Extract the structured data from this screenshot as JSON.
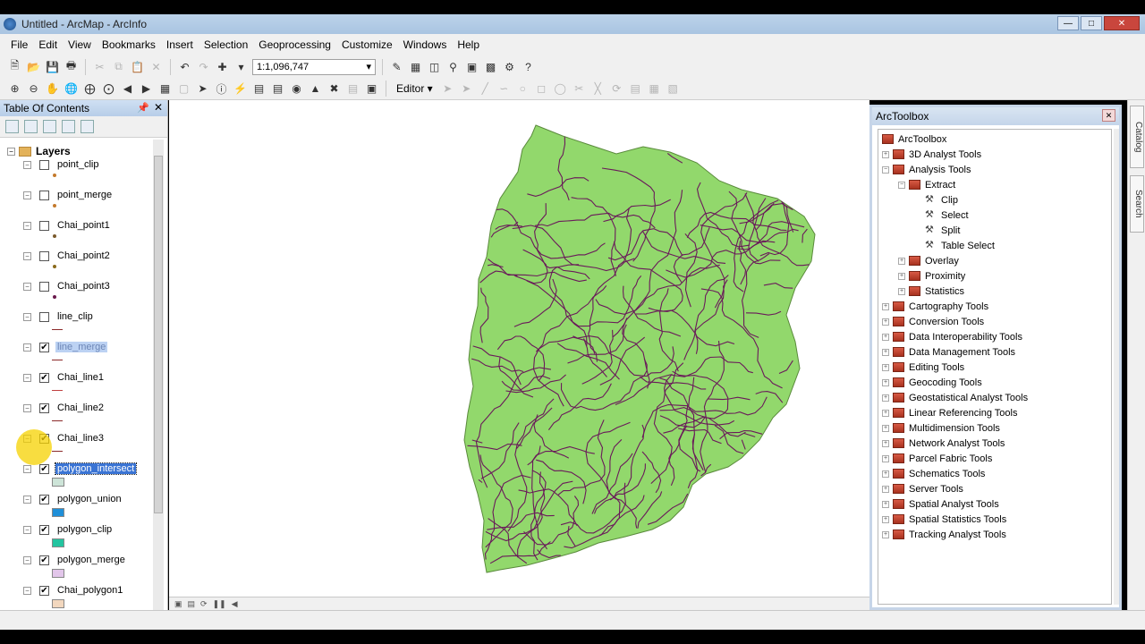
{
  "window": {
    "title": "Untitled - ArcMap - ArcInfo"
  },
  "menu": [
    "File",
    "Edit",
    "View",
    "Bookmarks",
    "Insert",
    "Selection",
    "Geoprocessing",
    "Customize",
    "Windows",
    "Help"
  ],
  "toolbar": {
    "scale_value": "1:1,096,747",
    "editor_label": "Editor ▾"
  },
  "toc": {
    "title": "Table Of Contents",
    "root_label": "Layers",
    "layers": [
      {
        "name": "point_clip",
        "checked": false,
        "symbol": "point",
        "color": "#c47a2c"
      },
      {
        "name": "point_merge",
        "checked": false,
        "symbol": "point",
        "color": "#c47a2c"
      },
      {
        "name": "Chai_point1",
        "checked": false,
        "symbol": "point",
        "color": "#7a5a2c"
      },
      {
        "name": "Chai_point2",
        "checked": false,
        "symbol": "point",
        "color": "#8a6a1c"
      },
      {
        "name": "Chai_point3",
        "checked": false,
        "symbol": "point",
        "color": "#6a1a4c"
      },
      {
        "name": "line_clip",
        "checked": false,
        "symbol": "line",
        "color": "#8b2a2a"
      },
      {
        "name": "line_merge",
        "checked": true,
        "symbol": "line",
        "color": "#8b2a2a"
      },
      {
        "name": "Chai_line1",
        "checked": true,
        "symbol": "line",
        "color": "#c04040"
      },
      {
        "name": "Chai_line2",
        "checked": true,
        "symbol": "line",
        "color": "#8b2a2a"
      },
      {
        "name": "Chai_line3",
        "checked": true,
        "symbol": "line",
        "color": "#8b2a2a"
      },
      {
        "name": "polygon_intersect",
        "checked": true,
        "symbol": "polygon",
        "color": "#cde4d8"
      },
      {
        "name": "polygon_union",
        "checked": true,
        "symbol": "polygon",
        "color": "#1f8fd8"
      },
      {
        "name": "polygon_clip",
        "checked": true,
        "symbol": "polygon",
        "color": "#23c4a0"
      },
      {
        "name": "polygon_merge",
        "checked": true,
        "symbol": "polygon",
        "color": "#e2c6ea"
      },
      {
        "name": "Chai_polygon1",
        "checked": true,
        "symbol": "polygon",
        "color": "#f2d7be"
      }
    ]
  },
  "arctoolbox": {
    "title": "ArcToolbox",
    "root": "ArcToolbox",
    "nodes": [
      {
        "label": "3D Analyst Tools",
        "level": 1,
        "kind": "toolbox",
        "exp": "+"
      },
      {
        "label": "Analysis Tools",
        "level": 1,
        "kind": "toolbox",
        "exp": "-"
      },
      {
        "label": "Extract",
        "level": 2,
        "kind": "toolbox",
        "exp": "-"
      },
      {
        "label": "Clip",
        "level": 3,
        "kind": "tool",
        "exp": ""
      },
      {
        "label": "Select",
        "level": 3,
        "kind": "tool",
        "exp": ""
      },
      {
        "label": "Split",
        "level": 3,
        "kind": "tool",
        "exp": ""
      },
      {
        "label": "Table Select",
        "level": 3,
        "kind": "tool",
        "exp": ""
      },
      {
        "label": "Overlay",
        "level": 2,
        "kind": "toolbox",
        "exp": "+"
      },
      {
        "label": "Proximity",
        "level": 2,
        "kind": "toolbox",
        "exp": "+"
      },
      {
        "label": "Statistics",
        "level": 2,
        "kind": "toolbox",
        "exp": "+"
      },
      {
        "label": "Cartography Tools",
        "level": 1,
        "kind": "toolbox",
        "exp": "+"
      },
      {
        "label": "Conversion Tools",
        "level": 1,
        "kind": "toolbox",
        "exp": "+"
      },
      {
        "label": "Data Interoperability Tools",
        "level": 1,
        "kind": "toolbox",
        "exp": "+"
      },
      {
        "label": "Data Management Tools",
        "level": 1,
        "kind": "toolbox",
        "exp": "+"
      },
      {
        "label": "Editing Tools",
        "level": 1,
        "kind": "toolbox",
        "exp": "+"
      },
      {
        "label": "Geocoding Tools",
        "level": 1,
        "kind": "toolbox",
        "exp": "+"
      },
      {
        "label": "Geostatistical Analyst Tools",
        "level": 1,
        "kind": "toolbox",
        "exp": "+"
      },
      {
        "label": "Linear Referencing Tools",
        "level": 1,
        "kind": "toolbox",
        "exp": "+"
      },
      {
        "label": "Multidimension Tools",
        "level": 1,
        "kind": "toolbox",
        "exp": "+"
      },
      {
        "label": "Network Analyst Tools",
        "level": 1,
        "kind": "toolbox",
        "exp": "+"
      },
      {
        "label": "Parcel Fabric Tools",
        "level": 1,
        "kind": "toolbox",
        "exp": "+"
      },
      {
        "label": "Schematics Tools",
        "level": 1,
        "kind": "toolbox",
        "exp": "+"
      },
      {
        "label": "Server Tools",
        "level": 1,
        "kind": "toolbox",
        "exp": "+"
      },
      {
        "label": "Spatial Analyst Tools",
        "level": 1,
        "kind": "toolbox",
        "exp": "+"
      },
      {
        "label": "Spatial Statistics Tools",
        "level": 1,
        "kind": "toolbox",
        "exp": "+"
      },
      {
        "label": "Tracking Analyst Tools",
        "level": 1,
        "kind": "toolbox",
        "exp": "+"
      }
    ]
  },
  "right_rail": {
    "catalog": "Catalog",
    "search": "Search"
  },
  "map": {
    "fill_color": "#92d86c",
    "road_color": "#6a1a5a"
  }
}
